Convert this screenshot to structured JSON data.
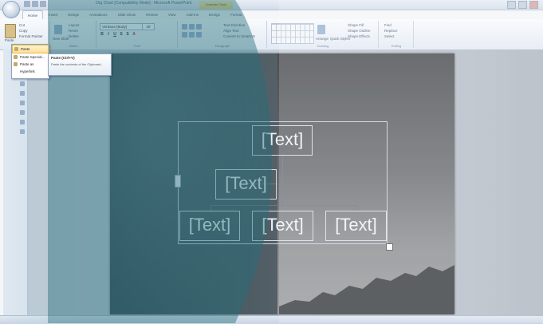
{
  "window": {
    "title": "Org Chart [Compatibility Mode] - Microsoft PowerPoint",
    "context_tab": "SmartArt Tools"
  },
  "ribbon": {
    "tabs": [
      "Home",
      "Insert",
      "Design",
      "Animations",
      "Slide Show",
      "Review",
      "View",
      "Add-Ins",
      "Design",
      "Format"
    ],
    "active_tab": "Home",
    "clipboard": {
      "paste": "Paste",
      "cut": "Cut",
      "copy": "Copy",
      "format_painter": "Format Painter",
      "label": "Clipboard"
    },
    "slides": {
      "new_slide": "New Slide",
      "layout": "Layout",
      "reset": "Reset",
      "delete": "Delete",
      "label": "Slides"
    },
    "font": {
      "family": "Verdana (Body)",
      "size": "28",
      "label": "Font"
    },
    "paragraph": {
      "label": "Paragraph",
      "text_direction": "Text Direction",
      "align_text": "Align Text",
      "convert": "Convert to SmartArt"
    },
    "drawing": {
      "arrange": "Arrange",
      "quick_styles": "Quick Styles",
      "shape_fill": "Shape Fill",
      "shape_outline": "Shape Outline",
      "shape_effects": "Shape Effects",
      "label": "Drawing"
    },
    "editing": {
      "find": "Find",
      "replace": "Replace",
      "select": "Select",
      "label": "Editing"
    }
  },
  "paste_menu": {
    "items": [
      "Paste",
      "Paste Special...",
      "Paste as Hyperlink"
    ],
    "selected": "Paste"
  },
  "tooltip": {
    "title": "Paste (Ctrl+V)",
    "description": "Paste the contents of the Clipboard."
  },
  "smartart": {
    "nodes": [
      "[Text]",
      "[Text]",
      "[Text]",
      "[Text]",
      "[Text]"
    ]
  },
  "colors": {
    "overlay": "#236e7d",
    "ribbon": "#e3eaf3",
    "slide_dark": "#3d4c55"
  }
}
